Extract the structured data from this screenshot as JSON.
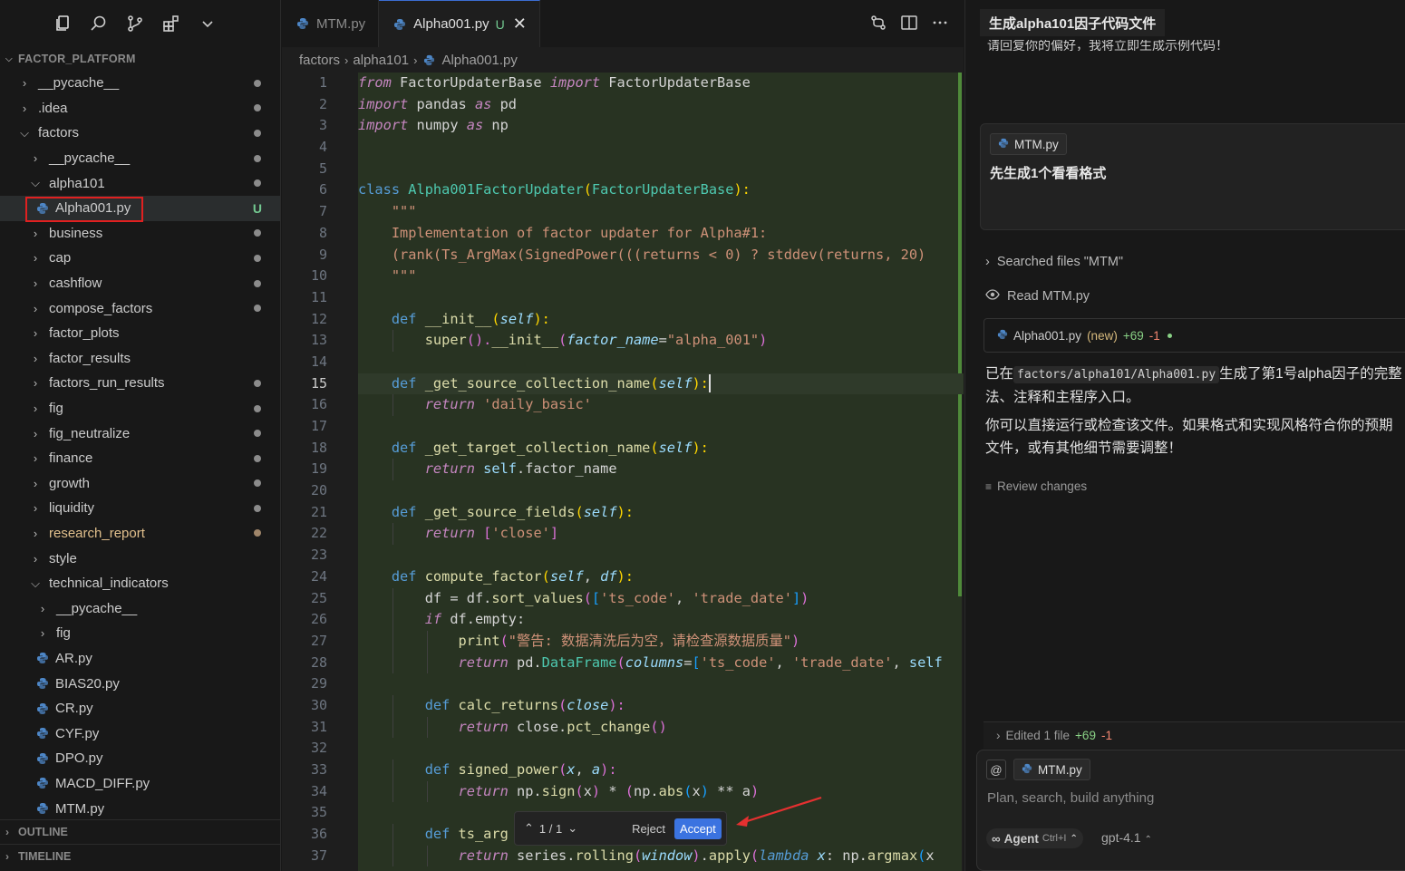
{
  "sidebar": {
    "section_title": "FACTOR_PLATFORM",
    "tree": [
      {
        "label": "__pycache__",
        "type": "folder",
        "indent": 1,
        "open": false,
        "status": "dot"
      },
      {
        "label": ".idea",
        "type": "folder",
        "indent": 1,
        "open": false,
        "status": "dot"
      },
      {
        "label": "factors",
        "type": "folder",
        "indent": 1,
        "open": true,
        "status": "dot"
      },
      {
        "label": "__pycache__",
        "type": "folder",
        "indent": 2,
        "open": false,
        "status": "dot"
      },
      {
        "label": "alpha101",
        "type": "folder",
        "indent": 2,
        "open": true,
        "status": "dot"
      },
      {
        "label": "Alpha001.py",
        "type": "file",
        "indent": 3,
        "status": "U",
        "selected": true
      },
      {
        "label": "business",
        "type": "folder",
        "indent": 2,
        "open": false,
        "status": "dot"
      },
      {
        "label": "cap",
        "type": "folder",
        "indent": 2,
        "open": false,
        "status": "dot"
      },
      {
        "label": "cashflow",
        "type": "folder",
        "indent": 2,
        "open": false,
        "status": "dot"
      },
      {
        "label": "compose_factors",
        "type": "folder",
        "indent": 2,
        "open": false,
        "status": "dot"
      },
      {
        "label": "factor_plots",
        "type": "folder",
        "indent": 2,
        "open": false,
        "status": ""
      },
      {
        "label": "factor_results",
        "type": "folder",
        "indent": 2,
        "open": false,
        "status": ""
      },
      {
        "label": "factors_run_results",
        "type": "folder",
        "indent": 2,
        "open": false,
        "status": "dot"
      },
      {
        "label": "fig",
        "type": "folder",
        "indent": 2,
        "open": false,
        "status": "dot"
      },
      {
        "label": "fig_neutralize",
        "type": "folder",
        "indent": 2,
        "open": false,
        "status": "dot"
      },
      {
        "label": "finance",
        "type": "folder",
        "indent": 2,
        "open": false,
        "status": "dot"
      },
      {
        "label": "growth",
        "type": "folder",
        "indent": 2,
        "open": false,
        "status": "dot"
      },
      {
        "label": "liquidity",
        "type": "folder",
        "indent": 2,
        "open": false,
        "status": "dot"
      },
      {
        "label": "research_report",
        "type": "folder",
        "indent": 2,
        "open": false,
        "status": "brown",
        "highlight": true
      },
      {
        "label": "style",
        "type": "folder",
        "indent": 2,
        "open": false,
        "status": ""
      },
      {
        "label": "technical_indicators",
        "type": "folder",
        "indent": 2,
        "open": true,
        "status": ""
      },
      {
        "label": "__pycache__",
        "type": "folder",
        "indent": 3,
        "open": false,
        "status": ""
      },
      {
        "label": "fig",
        "type": "folder",
        "indent": 3,
        "open": false,
        "status": ""
      },
      {
        "label": "AR.py",
        "type": "file",
        "indent": 3,
        "status": ""
      },
      {
        "label": "BIAS20.py",
        "type": "file",
        "indent": 3,
        "status": ""
      },
      {
        "label": "CR.py",
        "type": "file",
        "indent": 3,
        "status": ""
      },
      {
        "label": "CYF.py",
        "type": "file",
        "indent": 3,
        "status": ""
      },
      {
        "label": "DPO.py",
        "type": "file",
        "indent": 3,
        "status": ""
      },
      {
        "label": "MACD_DIFF.py",
        "type": "file",
        "indent": 3,
        "status": ""
      },
      {
        "label": "MTM.py",
        "type": "file",
        "indent": 3,
        "status": ""
      }
    ],
    "outline_label": "OUTLINE",
    "timeline_label": "TIMELINE"
  },
  "editor": {
    "tabs": [
      {
        "label": "MTM.py",
        "active": false,
        "status": ""
      },
      {
        "label": "Alpha001.py",
        "active": true,
        "status": "U"
      }
    ],
    "breadcrumb": [
      "factors",
      "alpha101",
      "Alpha001.py"
    ],
    "current_line": 15,
    "lines": [
      "1",
      "2",
      "3",
      "4",
      "5",
      "6",
      "7",
      "8",
      "9",
      "10",
      "11",
      "12",
      "13",
      "14",
      "15",
      "16",
      "17",
      "18",
      "19",
      "20",
      "21",
      "22",
      "23",
      "24",
      "25",
      "26",
      "27",
      "28",
      "29",
      "30",
      "31",
      "32",
      "33",
      "34",
      "35",
      "36",
      "37"
    ],
    "code_text": {
      "l1": [
        "from",
        " FactorUpdaterBase ",
        "import",
        " FactorUpdaterBase"
      ],
      "l2": [
        "import",
        " pandas ",
        "as",
        " pd"
      ],
      "l3": [
        "import",
        " numpy ",
        "as",
        " np"
      ],
      "l6": [
        "class",
        "Alpha001FactorUpdater",
        "(",
        "FactorUpdaterBase",
        "):"
      ],
      "l7": "\"\"\"",
      "l8": "Implementation of factor updater for Alpha#1:",
      "l9": "(rank(Ts_ArgMax(SignedPower(((returns < 0) ? stddev(returns, 20)",
      "l10": "\"\"\"",
      "l12": [
        "def",
        "__init__",
        "(",
        "self",
        "):"
      ],
      "l13": [
        "super",
        "().",
        "__init__",
        "(",
        "factor_name",
        "=",
        "\"alpha_001\"",
        ")"
      ],
      "l15": [
        "def",
        "_get_source_collection_name",
        "(",
        "self",
        "):"
      ],
      "l16": [
        "return",
        "'daily_basic'"
      ],
      "l18": [
        "def",
        "_get_target_collection_name",
        "(",
        "self",
        "):"
      ],
      "l19": [
        "return",
        "self",
        ".factor_name"
      ],
      "l21": [
        "def",
        "_get_source_fields",
        "(",
        "self",
        "):"
      ],
      "l22": [
        "return",
        "[",
        "'close'",
        "]"
      ],
      "l24": [
        "def",
        "compute_factor",
        "(",
        "self",
        ", ",
        "df",
        "):"
      ],
      "l25": [
        "df = df.",
        "sort_values",
        "(",
        "[",
        "'ts_code'",
        ", ",
        "'trade_date'",
        "]",
        ")"
      ],
      "l26": [
        "if",
        " df.empty:"
      ],
      "l27": [
        "print",
        "(",
        "\"警告: 数据清洗后为空，请检查源数据质量\"",
        ")"
      ],
      "l28": [
        "return",
        " pd.",
        "DataFrame",
        "(",
        "columns",
        "=",
        "[",
        "'ts_code'",
        ", ",
        "'trade_date'",
        ", ",
        "self"
      ],
      "l30": [
        "def",
        "calc_returns",
        "(",
        "close",
        "):"
      ],
      "l31": [
        "return",
        " close.",
        "pct_change",
        "()"
      ],
      "l33": [
        "def",
        "signed_power",
        "(",
        "x",
        ", ",
        "a",
        "):"
      ],
      "l34": [
        "return",
        " np.",
        "sign",
        "(",
        "x",
        ")",
        " * ",
        "(",
        "np.",
        "abs",
        "(",
        "x",
        ")",
        " ** a",
        ")"
      ],
      "l36": [
        "def",
        "ts_arg"
      ],
      "l37": [
        "return",
        " series.",
        "rolling",
        "(",
        "window",
        ")",
        ".",
        "apply",
        "(",
        "lambda",
        " x",
        ": np.",
        "argmax",
        "(",
        "x"
      ]
    },
    "diff_bar": {
      "counter": "1 / 1",
      "reject_label": "Reject",
      "accept_label": "Accept"
    }
  },
  "chat": {
    "title": "生成alpha101因子代码文件",
    "cut_text": "请回复你的偏好，我将立即生成示例代码！",
    "user_message": {
      "file_chip": "MTM.py",
      "text": "先生成1个看看格式"
    },
    "steps": [
      {
        "icon": "chevron-right",
        "label": "Searched files \"MTM\""
      },
      {
        "icon": "eye",
        "label": "Read MTM.py"
      }
    ],
    "edit_card": {
      "file": "Alpha001.py",
      "tag": "(new)",
      "added": "+69",
      "removed": "-1"
    },
    "answer_1_prefix": "已在",
    "answer_1_code": "factors/alpha101/Alpha001.py",
    "answer_1_suffix": "生成了第1号alpha因子的完整",
    "answer_1_line2": "法、注释和主程序入口。",
    "answer_2_line1": "你可以直接运行或检查该文件。如果格式和实现风格符合你的预期",
    "answer_2_line2": "文件，或有其他细节需要调整！",
    "review_label": "Review changes",
    "edited_summary": {
      "label": "Edited 1 file",
      "added": "+69",
      "removed": "-1"
    },
    "input": {
      "at_label": "@",
      "file_chip": "MTM.py",
      "placeholder": "Plan, search, build anything",
      "agent_label": "Agent",
      "agent_shortcut": "Ctrl+I",
      "model_label": "gpt-4.1"
    }
  }
}
